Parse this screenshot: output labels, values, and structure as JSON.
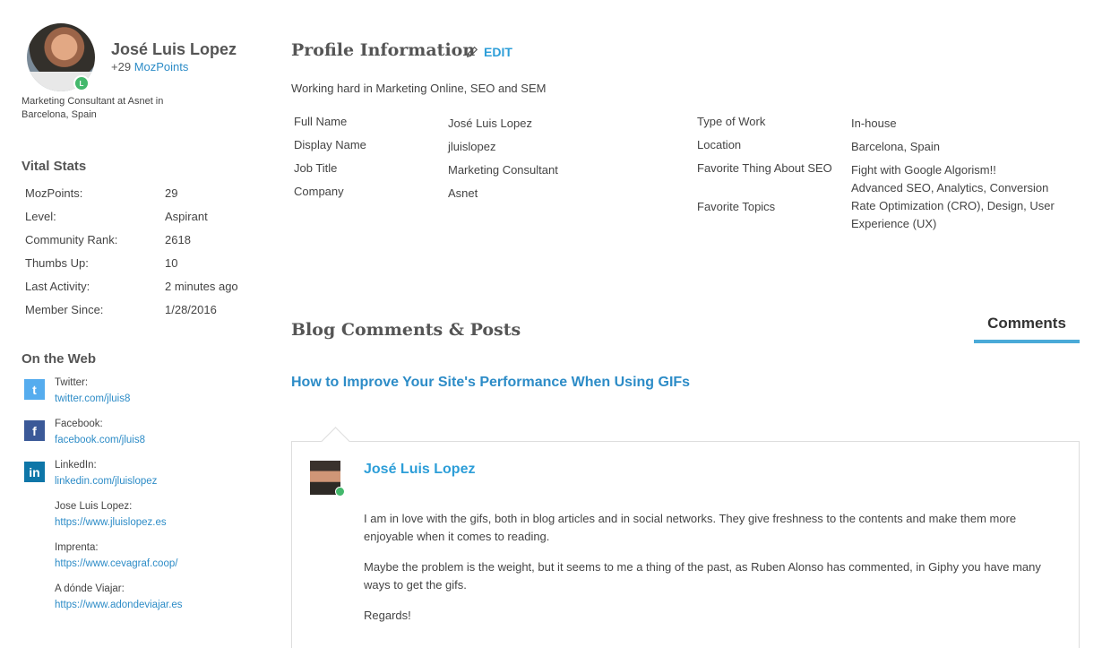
{
  "user": {
    "name": "José Luis Lopez",
    "points_prefix": "+29",
    "points_link": "MozPoints",
    "job": "Marketing Consultant at Asnet in Barcelona, Spain",
    "badge_text": "L"
  },
  "vital_stats": {
    "title": "Vital Stats",
    "rows": [
      {
        "label": "MozPoints:",
        "value": "29"
      },
      {
        "label": "Level:",
        "value": "Aspirant"
      },
      {
        "label": "Community Rank:",
        "value": "2618"
      },
      {
        "label": "Thumbs Up:",
        "value": "10"
      },
      {
        "label": "Last Activity:",
        "value": "2 minutes ago"
      },
      {
        "label": "Member Since:",
        "value": "1/28/2016"
      }
    ]
  },
  "on_the_web": {
    "title": "On the Web",
    "items": [
      {
        "label": "Twitter:",
        "link": "twitter.com/jluis8",
        "icon": "twitter-icon",
        "color": "#55acee",
        "glyph": "t"
      },
      {
        "label": "Facebook:",
        "link": "facebook.com/jluis8",
        "icon": "facebook-icon",
        "color": "#3b5998",
        "glyph": "f"
      },
      {
        "label": "LinkedIn:",
        "link": "linkedin.com/jluislopez",
        "icon": "linkedin-icon",
        "color": "#0e76a8",
        "glyph": "in"
      },
      {
        "label": "Jose Luis Lopez:",
        "link": "https://www.jluislopez.es"
      },
      {
        "label": "Imprenta:",
        "link": "https://www.cevagraf.coop/"
      },
      {
        "label": "A dónde Viajar:",
        "link": "https://www.adondeviajar.es"
      }
    ]
  },
  "profile": {
    "title": "Profile Information",
    "edit_label": "EDIT",
    "tagline": "Working hard in Marketing Online, SEO and SEM",
    "left_fields": [
      {
        "label": "Full Name",
        "value": "José Luis Lopez"
      },
      {
        "label": "Display Name",
        "value": "jluislopez"
      },
      {
        "label": "Job Title",
        "value": "Marketing Consultant"
      },
      {
        "label": "Company",
        "value": "Asnet"
      }
    ],
    "right_fields": [
      {
        "label": "Type of Work",
        "value": "In-house"
      },
      {
        "label": "Location",
        "value": "Barcelona, Spain"
      },
      {
        "label": "Favorite Thing About SEO",
        "value": "Fight with Google Algorism!!"
      },
      {
        "label": "Favorite Topics",
        "value": "Advanced SEO, Analytics, Conversion Rate Optimization (CRO), Design, User Experience (UX)"
      }
    ]
  },
  "blog": {
    "title": "Blog Comments & Posts",
    "tab_label": "Comments",
    "post_title": "How to Improve Your Site's Performance When Using GIFs",
    "comment": {
      "author": "José Luis Lopez",
      "paragraphs": [
        "I am in love with the gifs, both in blog articles and in social networks. They give freshness to the contents and make them more enjoyable when it comes to reading.",
        "Maybe the problem is the weight, but it seems to me a thing of the past, as Ruben Alonso has commented, in Giphy you have many ways to get the gifs.",
        "Regards!"
      ]
    }
  },
  "colors": {
    "link": "#2d8cc7",
    "accent": "#4aaad8",
    "badge": "#44b86c"
  }
}
